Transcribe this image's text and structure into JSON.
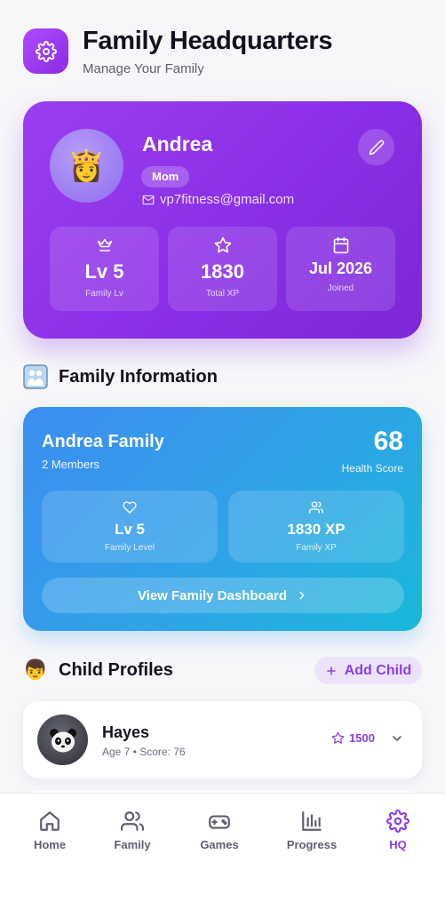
{
  "header": {
    "title": "Family Headquarters",
    "subtitle": "Manage Your Family",
    "icon": "gear-icon"
  },
  "profile": {
    "avatar_emoji": "👸",
    "name": "Andrea",
    "role": "Mom",
    "email": "vp7fitness@gmail.com",
    "stats": [
      {
        "icon": "crown-icon",
        "value": "Lv 5",
        "label": "Family Lv"
      },
      {
        "icon": "star-icon",
        "value": "1830",
        "label": "Total XP"
      },
      {
        "icon": "calendar-icon",
        "value": "Jul 2026",
        "label": "Joined"
      }
    ]
  },
  "family_section": {
    "heading": "Family Information",
    "emoji": "👨‍👩‍👧"
  },
  "family": {
    "name": "Andrea Family",
    "members": "2 Members",
    "health_score": "68",
    "health_label": "Health Score",
    "stats": [
      {
        "icon": "heart-icon",
        "value": "Lv 5",
        "label": "Family Level"
      },
      {
        "icon": "users-icon",
        "value": "1830 XP",
        "label": "Family XP"
      }
    ],
    "dashboard_button": "View Family Dashboard"
  },
  "children_section": {
    "heading": "Child Profiles",
    "emoji": "👦",
    "add_button": "Add Child"
  },
  "children": [
    {
      "name": "Hayes",
      "meta": "Age 7 • Score: 76",
      "points": "1500",
      "avatar": "panda"
    }
  ],
  "nav": {
    "items": [
      {
        "label": "Home",
        "icon": "home-icon"
      },
      {
        "label": "Family",
        "icon": "users-icon"
      },
      {
        "label": "Games",
        "icon": "gamepad-icon"
      },
      {
        "label": "Progress",
        "icon": "bar-chart-icon"
      },
      {
        "label": "HQ",
        "icon": "gear-icon"
      }
    ],
    "active": "HQ"
  },
  "colors": {
    "accent": "#8a3ee8",
    "profile_card": "#8a2fe6",
    "family_card": "#2fa3e8"
  }
}
